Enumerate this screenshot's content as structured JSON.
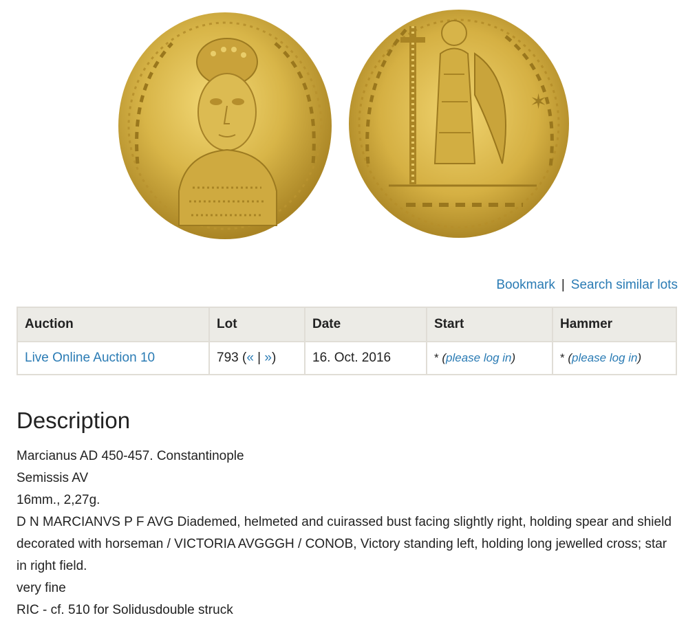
{
  "images": {
    "obverse_alt": "Coin obverse",
    "reverse_alt": "Coin reverse",
    "coin_color": "#d8b548"
  },
  "actions": {
    "bookmark": "Bookmark",
    "separator": "|",
    "search_similar": "Search similar lots"
  },
  "table": {
    "headers": [
      "Auction",
      "Lot",
      "Date",
      "Start",
      "Hammer"
    ],
    "row": {
      "auction": "Live Online Auction 10",
      "lot_number": "793",
      "lot_prev": "«",
      "lot_sep": "|",
      "lot_next": "»",
      "date": "16. Oct. 2016",
      "start_star": "*",
      "start_link": "please log in",
      "hammer_star": "*",
      "hammer_link": "please log in"
    }
  },
  "description": {
    "title": "Description",
    "lines": [
      "Marcianus AD 450-457. Constantinople",
      "Semissis AV",
      "16mm., 2,27g.",
      "D N MARCIANVS P F AVG Diademed, helmeted and cuirassed bust facing slightly right, holding spear and shield decorated with horseman / VICTORIA AVGGGH / CONOB, Victory standing left, holding long jewelled cross; star in right field.",
      "very fine",
      "RIC - cf. 510 for Solidusdouble struck"
    ]
  },
  "colors": {
    "link": "#2a7bb4",
    "header_bg": "#ecebe6",
    "border": "#e0ddd6",
    "text": "#222222"
  }
}
